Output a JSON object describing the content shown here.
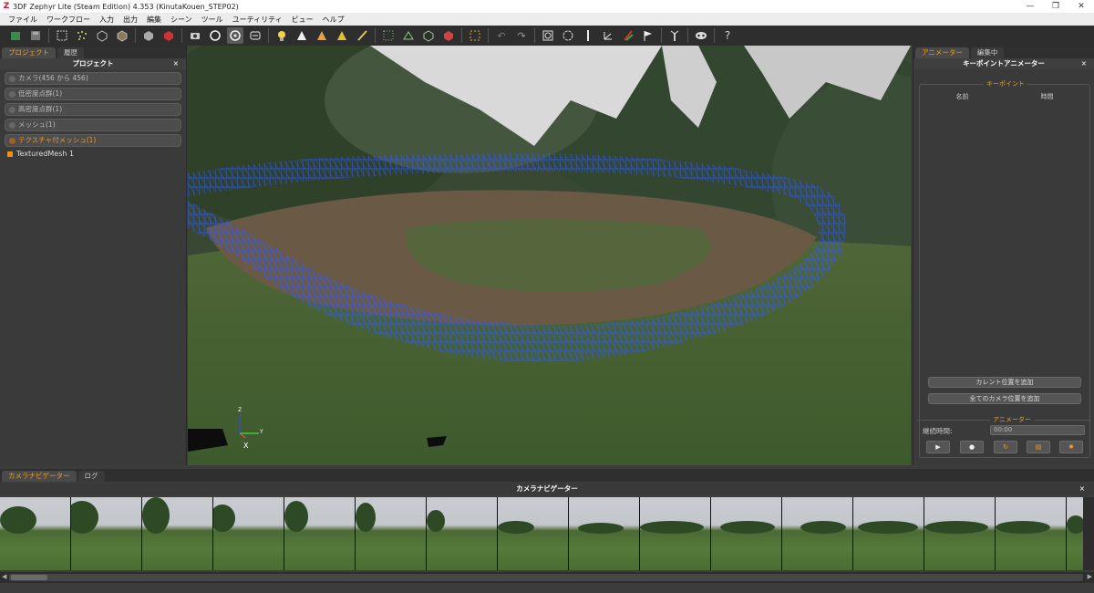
{
  "window": {
    "title": "3DF Zephyr Lite (Steam Edition) 4.353 (KinutaKouen_STEP02)",
    "controls": [
      "—",
      "❐",
      "✕"
    ]
  },
  "menu": [
    "ファイル",
    "ワークフロー",
    "入力",
    "出力",
    "編集",
    "シーン",
    "ツール",
    "ユーティリティ",
    "ビュー",
    "ヘルプ"
  ],
  "toolbar": {
    "icons": [
      "project-new-icon",
      "save-icon",
      "select-icon",
      "points-icon",
      "cube-icon",
      "cube-solid-icon",
      "object-icon",
      "object-red-icon",
      "camera-icon",
      "rotate-icon",
      "orbit-icon",
      "pan-icon",
      "light-icon",
      "triangle-icon",
      "triangle-color-icon",
      "triangle-yellow-icon",
      "brush-icon",
      "points-select-icon",
      "mesh-icon",
      "box-icon",
      "box-red-icon",
      "crop-icon",
      "undo-icon",
      "redo-icon",
      "transform-icon",
      "circle-icon",
      "measure-icon",
      "axis-icon",
      "reference-icon",
      "flag-icon",
      "tool-icon",
      "mask-icon",
      "help-icon"
    ],
    "active_index": 10
  },
  "left_panel": {
    "tabs": [
      "プロジェクト",
      "履歴"
    ],
    "title": "プロジェクト",
    "close": "×",
    "groups": [
      {
        "label": "カメラ(456 から 456)",
        "highlight": false
      },
      {
        "label": "低密度点群(1)",
        "highlight": false
      },
      {
        "label": "高密度点群(1)",
        "highlight": false
      },
      {
        "label": "メッシュ(1)",
        "highlight": false
      },
      {
        "label": "テクスチャ付メッシュ(1)",
        "highlight": true
      }
    ],
    "mesh_item": "TexturedMesh 1"
  },
  "viewport": {
    "axis_labels": {
      "z": "Z",
      "y": "Y",
      "x": "X"
    }
  },
  "right_panel": {
    "tabs": [
      "アニメーター",
      "編集中"
    ],
    "title": "キーポイントアニメーター",
    "close": "×",
    "keypoint_legend": "キーポイント",
    "columns": [
      "名前",
      "時間"
    ],
    "add_current_button": "カレント位置を追加",
    "add_all_button": "全てのカメラ位置を追加",
    "animator_legend": "アニメーター",
    "duration_label": "継続時間:",
    "duration_value": "00:00",
    "playback_icons": [
      "play-icon",
      "record-icon",
      "loop-icon",
      "film-icon",
      "settings-icon"
    ]
  },
  "bottom": {
    "tabs": [
      "カメラナビゲーター",
      "ログ"
    ],
    "title": "カメラナビゲーター",
    "close": "×",
    "thumbnail_count": 16
  },
  "colors": {
    "accent": "#f0a020",
    "wireframe": "#1f4fff",
    "panel": "#3a3a3a"
  }
}
